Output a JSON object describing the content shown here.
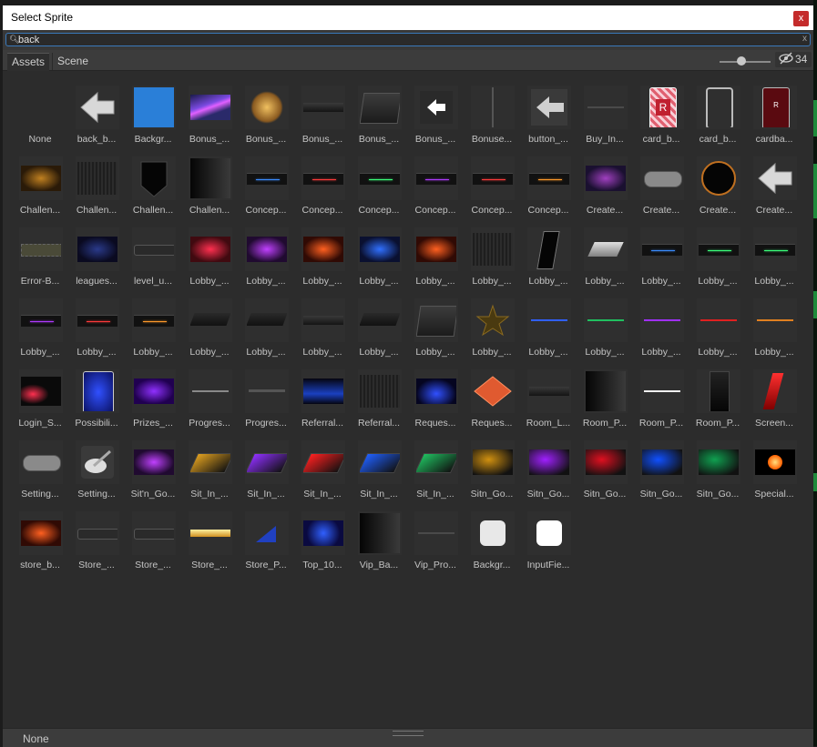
{
  "window": {
    "title": "Select Sprite",
    "close_label": "x"
  },
  "search": {
    "value": "back",
    "search_icon": "search-icon",
    "clear_label": "x"
  },
  "tabs": [
    {
      "label": "Assets"
    },
    {
      "label": "Scene"
    }
  ],
  "hidden_count": "34",
  "status": {
    "selected": "None"
  },
  "assets": [
    {
      "label": "None",
      "icon": "none"
    },
    {
      "label": "back_b...",
      "icon": "arrow-left-large"
    },
    {
      "label": "Backgr...",
      "icon": "blue-square"
    },
    {
      "label": "Bonus_...",
      "icon": "purple-streak"
    },
    {
      "label": "Bonus_...",
      "icon": "gold-character"
    },
    {
      "label": "Bonus_...",
      "icon": "dark-bar"
    },
    {
      "label": "Bonus_...",
      "icon": "dark-panel"
    },
    {
      "label": "Bonus_...",
      "icon": "arrow-left-small"
    },
    {
      "label": "Bonuse...",
      "icon": "vertical-line"
    },
    {
      "label": "button_...",
      "icon": "arrow-left-gray"
    },
    {
      "label": "Buy_In...",
      "icon": "thin-line"
    },
    {
      "label": "card_b...",
      "icon": "red-card"
    },
    {
      "label": "card_b...",
      "icon": "card-outline"
    },
    {
      "label": "cardba...",
      "icon": "dark-red-card"
    },
    {
      "label": "Challen...",
      "icon": "gold-sparkle"
    },
    {
      "label": "Challen...",
      "icon": "dark-texture"
    },
    {
      "label": "Challen...",
      "icon": "black-shield"
    },
    {
      "label": "Challen...",
      "icon": "dark-gradient"
    },
    {
      "label": "Concep...",
      "icon": "bar-blue"
    },
    {
      "label": "Concep...",
      "icon": "bar-red"
    },
    {
      "label": "Concep...",
      "icon": "bar-green"
    },
    {
      "label": "Concep...",
      "icon": "bar-purple"
    },
    {
      "label": "Concep...",
      "icon": "bar-red"
    },
    {
      "label": "Concep...",
      "icon": "bar-orange"
    },
    {
      "label": "Create...",
      "icon": "purple-galaxy"
    },
    {
      "label": "Create...",
      "icon": "gray-pill"
    },
    {
      "label": "Create...",
      "icon": "black-circle"
    },
    {
      "label": "Create...",
      "icon": "arrow-left-large"
    },
    {
      "label": "Error-B...",
      "icon": "olive-bar"
    },
    {
      "label": "leagues...",
      "icon": "blue-space"
    },
    {
      "label": "level_u...",
      "icon": "dark-pill"
    },
    {
      "label": "Lobby_...",
      "icon": "red-glow"
    },
    {
      "label": "Lobby_...",
      "icon": "purple-glow"
    },
    {
      "label": "Lobby_...",
      "icon": "orange-glow"
    },
    {
      "label": "Lobby_...",
      "icon": "blue-glow"
    },
    {
      "label": "Lobby_...",
      "icon": "orange-glow"
    },
    {
      "label": "Lobby_...",
      "icon": "dark-texture"
    },
    {
      "label": "Lobby_...",
      "icon": "black-slant-tall"
    },
    {
      "label": "Lobby_...",
      "icon": "silver-parallelogram"
    },
    {
      "label": "Lobby_...",
      "icon": "bar-blue"
    },
    {
      "label": "Lobby_...",
      "icon": "bar-green"
    },
    {
      "label": "Lobby_...",
      "icon": "bar-green"
    },
    {
      "label": "Lobby_...",
      "icon": "bar-purple"
    },
    {
      "label": "Lobby_...",
      "icon": "bar-red"
    },
    {
      "label": "Lobby_...",
      "icon": "bar-orange"
    },
    {
      "label": "Lobby_...",
      "icon": "dark-slant"
    },
    {
      "label": "Lobby_...",
      "icon": "dark-slant"
    },
    {
      "label": "Lobby_...",
      "icon": "dark-bar"
    },
    {
      "label": "Lobby_...",
      "icon": "dark-slant"
    },
    {
      "label": "Lobby_...",
      "icon": "dark-panel"
    },
    {
      "label": "Lobby_...",
      "icon": "star"
    },
    {
      "label": "Lobby_...",
      "icon": "line-blue"
    },
    {
      "label": "Lobby_...",
      "icon": "line-green"
    },
    {
      "label": "Lobby_...",
      "icon": "line-purple"
    },
    {
      "label": "Lobby_...",
      "icon": "line-red"
    },
    {
      "label": "Lobby_...",
      "icon": "line-orange"
    },
    {
      "label": "Login_S...",
      "icon": "login-dark"
    },
    {
      "label": "Possibili...",
      "icon": "blue-card"
    },
    {
      "label": "Prizes_...",
      "icon": "purple-prizes"
    },
    {
      "label": "Progres...",
      "icon": "gray-line"
    },
    {
      "label": "Progres...",
      "icon": "gray-line-thick"
    },
    {
      "label": "Referral...",
      "icon": "blue-horizon"
    },
    {
      "label": "Referral...",
      "icon": "dark-texture"
    },
    {
      "label": "Reques...",
      "icon": "blue-spotlight"
    },
    {
      "label": "Reques...",
      "icon": "orange-diamond"
    },
    {
      "label": "Room_L...",
      "icon": "dark-bar"
    },
    {
      "label": "Room_P...",
      "icon": "dark-gradient"
    },
    {
      "label": "Room_P...",
      "icon": "white-line"
    },
    {
      "label": "Room_P...",
      "icon": "black-tall"
    },
    {
      "label": "Screen...",
      "icon": "red-slash"
    },
    {
      "label": "Setting...",
      "icon": "gray-pill"
    },
    {
      "label": "Setting...",
      "icon": "pen-icon"
    },
    {
      "label": "Sit'n_Go...",
      "icon": "purple-glow"
    },
    {
      "label": "Sit_In_...",
      "icon": "sit-gold"
    },
    {
      "label": "Sit_In_...",
      "icon": "sit-purple"
    },
    {
      "label": "Sit_In_...",
      "icon": "sit-red"
    },
    {
      "label": "Sit_In_...",
      "icon": "sit-blue"
    },
    {
      "label": "Sit_In_...",
      "icon": "sit-green"
    },
    {
      "label": "Sitn_Go...",
      "icon": "sitn-gold"
    },
    {
      "label": "Sitn_Go...",
      "icon": "sitn-purple"
    },
    {
      "label": "Sitn_Go...",
      "icon": "sitn-red"
    },
    {
      "label": "Sitn_Go...",
      "icon": "sitn-blue"
    },
    {
      "label": "Sitn_Go...",
      "icon": "sitn-green"
    },
    {
      "label": "Special...",
      "icon": "fire-ball"
    },
    {
      "label": "store_b...",
      "icon": "orange-glow"
    },
    {
      "label": "Store_...",
      "icon": "dark-pill"
    },
    {
      "label": "Store_...",
      "icon": "dark-pill"
    },
    {
      "label": "Store_...",
      "icon": "gold-bar"
    },
    {
      "label": "Store_P...",
      "icon": "blue-triangle"
    },
    {
      "label": "Top_10...",
      "icon": "blue-dots"
    },
    {
      "label": "Vip_Ba...",
      "icon": "dark-gradient"
    },
    {
      "label": "Vip_Pro...",
      "icon": "thin-line"
    },
    {
      "label": "Backgr...",
      "icon": "rounded-white-gray"
    },
    {
      "label": "InputFie...",
      "icon": "rounded-white"
    }
  ]
}
